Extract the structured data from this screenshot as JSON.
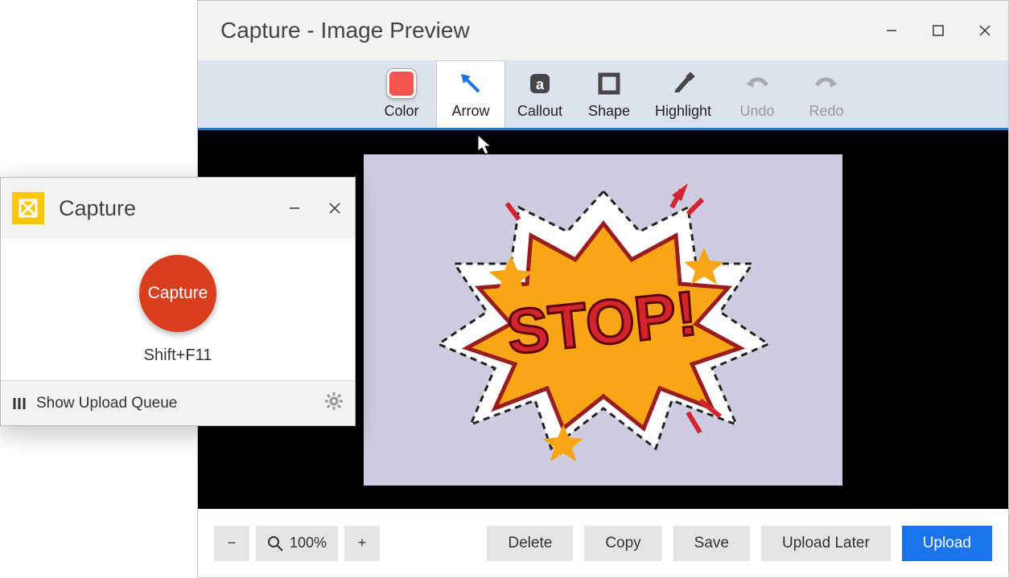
{
  "preview": {
    "title": "Capture - Image Preview",
    "toolbar": {
      "color": "Color",
      "arrow": "Arrow",
      "callout": "Callout",
      "shape": "Shape",
      "highlight": "Highlight",
      "undo": "Undo",
      "redo": "Redo",
      "swatch_color": "#f5544f"
    },
    "canvas": {
      "sticker_text": "STOP!"
    },
    "zoom": {
      "out": "−",
      "level": "100%",
      "in": "+"
    },
    "actions": {
      "delete": "Delete",
      "copy": "Copy",
      "save": "Save",
      "upload_later": "Upload Later",
      "upload": "Upload"
    }
  },
  "widget": {
    "title": "Capture",
    "capture_label": "Capture",
    "shortcut": "Shift+F11",
    "queue_label": "Show Upload Queue"
  }
}
